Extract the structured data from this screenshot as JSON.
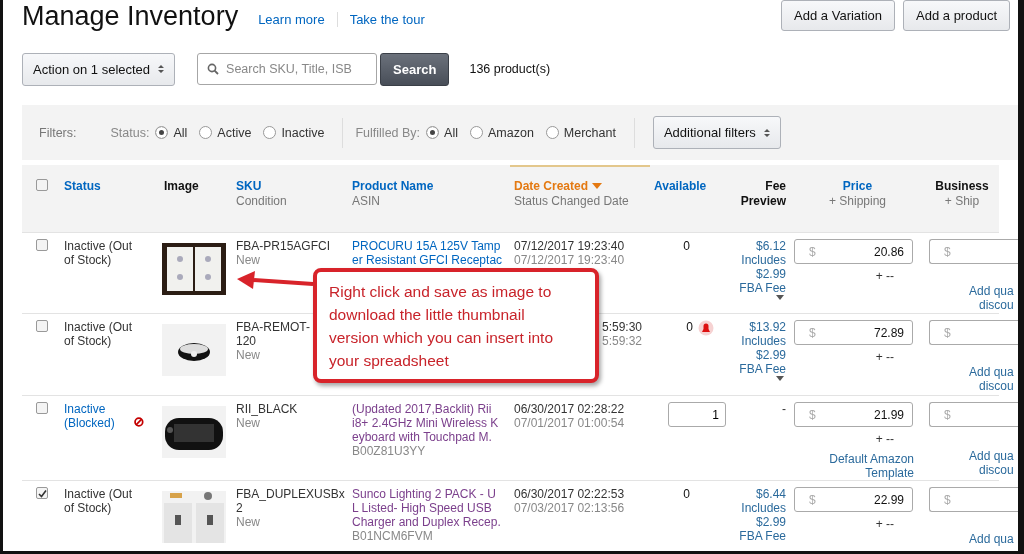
{
  "header": {
    "title": "Manage Inventory",
    "links": [
      "Learn more",
      "Take the tour"
    ],
    "buttons": [
      "Add a Variation",
      "Add a product"
    ]
  },
  "toolbar": {
    "action": "Action on 1 selected",
    "search_placeholder": "Search SKU, Title, ISB",
    "search_button": "Search",
    "count": "136 product(s)"
  },
  "filters": {
    "label": "Filters:",
    "groups": [
      {
        "label": "Status:",
        "options": [
          {
            "label": "All",
            "selected": true
          },
          {
            "label": "Active",
            "selected": false
          },
          {
            "label": "Inactive",
            "selected": false
          }
        ]
      },
      {
        "label": "Fulfilled By:",
        "options": [
          {
            "label": "All",
            "selected": true
          },
          {
            "label": "Amazon",
            "selected": false
          },
          {
            "label": "Merchant",
            "selected": false
          }
        ]
      }
    ],
    "more": "Additional filters"
  },
  "table": {
    "select_all": {
      "checked": false
    },
    "columns": [
      {
        "label": "Status",
        "link": true,
        "sorted": false
      },
      {
        "label": "Image",
        "link": false,
        "sorted": false
      },
      {
        "label": "SKU",
        "sublabel": "Condition",
        "link": true,
        "sorted": false
      },
      {
        "label": "Product Name",
        "sublabel": "ASIN",
        "link": true,
        "sorted": false
      },
      {
        "label": "Date Created",
        "sublabel": "Status Changed Date",
        "link": true,
        "sorted": true
      },
      {
        "label": "Available",
        "link": true,
        "sorted": false
      },
      {
        "label": "Fee",
        "sublabel": "Preview",
        "link": false,
        "sorted": false
      },
      {
        "label": "Price",
        "sublabel": "+ Shipping",
        "link": true,
        "sorted": false
      },
      {
        "label": "Business",
        "sublabel": "+ Ship",
        "link": false,
        "sorted": false
      }
    ],
    "rows": [
      {
        "checked": false,
        "status": "Inactive (Out of Stock)",
        "blocked": false,
        "image": {
          "kind": "picture"
        },
        "sku": "FBA-PR15AGFCI",
        "condition": "New",
        "product_lines": [
          "PROCURU 15A 125V Tamp",
          "er Resistant GFCI Receptac"
        ],
        "visited": false,
        "date_created": "07/12/2017 19:23:40",
        "status_changed": "07/12/2017 19:23:40",
        "available": "0",
        "editable": false,
        "alert": false,
        "fee_lines": [
          "$6.12",
          "Includes",
          "$2.99",
          "FBA Fee"
        ],
        "fee_expandable": true,
        "price": "20.86",
        "currency": "$",
        "shipping": "+ --",
        "business_currency": "$",
        "discount_lines": [
          "Add qua",
          "discou"
        ]
      },
      {
        "checked": false,
        "status": "Inactive (Out of Stock)",
        "blocked": false,
        "image": {
          "kind": "picture"
        },
        "sku": "FBA-REMOT-",
        "sku_more": "120",
        "condition": "New",
        "date_created": "5:59:30",
        "status_changed": "5:59:32",
        "available": "0",
        "editable": false,
        "alert": true,
        "fee_lines": [
          "$13.92",
          "Includes",
          "$2.99",
          "FBA Fee"
        ],
        "fee_expandable": true,
        "price": "72.89",
        "currency": "$",
        "shipping": "+ --",
        "business_currency": "$",
        "discount_lines": [
          "Add qua",
          "discou"
        ]
      },
      {
        "checked": false,
        "status": "Inactive (Blocked)",
        "blocked": true,
        "image": {
          "kind": "picture"
        },
        "sku": "RII_BLACK",
        "condition": "New",
        "product_lines": [
          "(Updated 2017,Backlit) Rii",
          "i8+ 2.4GHz Mini Wireless K",
          "eyboard with Touchpad M."
        ],
        "visited": true,
        "asin": "B00Z81U3YY",
        "date_created": "06/30/2017 02:28:22",
        "status_changed": "07/01/2017 01:00:54",
        "available": "1",
        "editable": true,
        "alert": false,
        "fee_lines": [
          "-"
        ],
        "fee_expandable": false,
        "price": "21.99",
        "currency": "$",
        "shipping": "+ --",
        "template_lines": [
          "Default Amazon",
          "Template"
        ],
        "business_currency": "$",
        "discount_lines": [
          "Add qua",
          "discou"
        ]
      },
      {
        "checked": true,
        "status": "Inactive (Out of Stock)",
        "blocked": false,
        "image": {
          "kind": "picture"
        },
        "sku": "FBA_DUPLEXUSBx",
        "sku_more": "2",
        "condition": "New",
        "product_lines": [
          "Sunco Lighting 2 PACK - U",
          "L Listed- High Speed USB",
          "Charger and Duplex Recep."
        ],
        "visited": true,
        "asin": "B01NCM6FVM",
        "date_created": "06/30/2017 02:22:53",
        "status_changed": "07/03/2017 02:13:56",
        "available": "0",
        "editable": false,
        "alert": false,
        "fee_lines": [
          "$6.44",
          "Includes",
          "$2.99",
          "FBA Fee"
        ],
        "fee_expandable": false,
        "price": "22.99",
        "currency": "$",
        "shipping": "+ --",
        "business_currency": "$",
        "discount_lines": [
          "Add qua"
        ]
      }
    ]
  },
  "callout": {
    "lines": [
      "Right click and save as image to",
      "download the little thumbnail",
      "version which you can insert into",
      "your spreadsheet"
    ]
  }
}
